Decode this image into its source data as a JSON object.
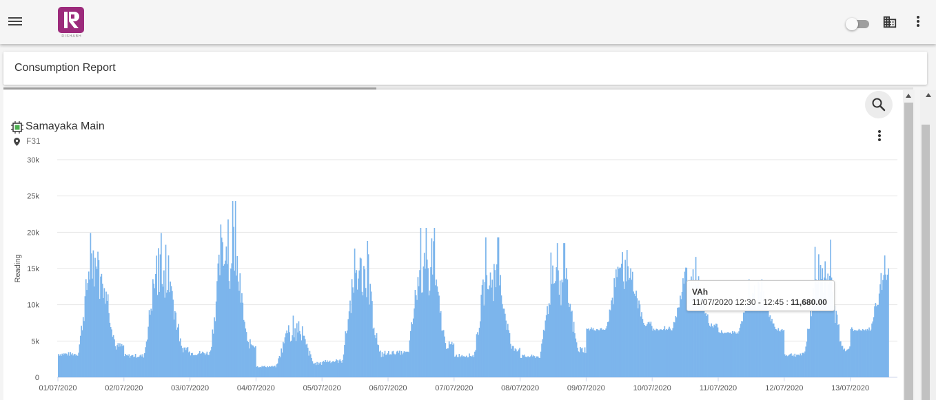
{
  "header": {
    "menu_icon": "hamburger-menu-icon",
    "logo_letter": "R",
    "logo_text": "RISHABH",
    "toggle_state": "off",
    "building_icon": "building-icon",
    "more_icon": "more-vert-icon"
  },
  "page": {
    "title": "Consumption Report"
  },
  "card": {
    "device_name": "Samayaka Main",
    "location": "F31",
    "search_icon": "search-icon",
    "more_icon": "more-vert-icon"
  },
  "colors": {
    "accent": "#9c2a7b",
    "bar": "#7cb5ec"
  },
  "chart_data": {
    "type": "bar",
    "ylabel": "Reading",
    "ylim": [
      0,
      30000
    ],
    "yticks": [
      0,
      5000,
      10000,
      15000,
      20000,
      25000,
      30000
    ],
    "ytick_labels": [
      "0",
      "5k",
      "10k",
      "15k",
      "20k",
      "25k",
      "30k"
    ],
    "x_labels": [
      "01/07/2020",
      "02/07/2020",
      "03/07/2020",
      "04/07/2020",
      "05/07/2020",
      "06/07/2020",
      "07/07/2020",
      "08/07/2020",
      "09/07/2020",
      "10/07/2020",
      "11/07/2020",
      "12/07/2020",
      "13/07/2020"
    ],
    "grid": true,
    "series": [
      {
        "name": "VAh",
        "daily_peak": [
          20800,
          19900,
          24300,
          8500,
          18800,
          20600,
          19300,
          18500,
          18400,
          16600,
          13500,
          19400,
          16800
        ],
        "daily_base": [
          2000,
          1800,
          1900,
          1000,
          1100,
          2200,
          1900,
          1800,
          5800,
          5900,
          5600,
          2000,
          5800
        ]
      }
    ],
    "tooltip": {
      "series": "VAh",
      "range": "11/07/2020 12:30 - 12:45 : ",
      "value": "11,680.00"
    }
  }
}
